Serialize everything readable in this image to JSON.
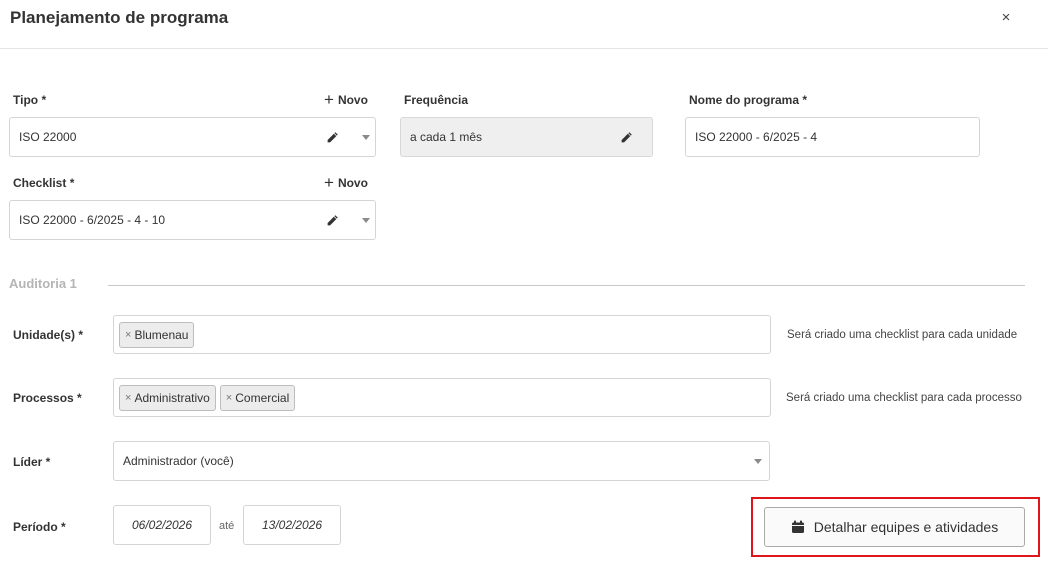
{
  "modal": {
    "title": "Planejamento de programa",
    "close": "×"
  },
  "form": {
    "tipo": {
      "label": "Tipo *",
      "value": "ISO 22000",
      "novo_label": "Novo"
    },
    "frequencia": {
      "label": "Frequência",
      "value": "a cada 1 mês"
    },
    "nome_programa": {
      "label": "Nome do programa *",
      "value": "ISO 22000 - 6/2025 - 4"
    },
    "checklist": {
      "label": "Checklist *",
      "value": "ISO 22000 - 6/2025 - 4 - 10",
      "novo_label": "Novo"
    }
  },
  "auditoria": {
    "title": "Auditoria 1",
    "unidades": {
      "label": "Unidade(s) *",
      "tags": [
        "Blumenau"
      ],
      "hint": "Será criado uma checklist para cada unidade"
    },
    "processos": {
      "label": "Processos *",
      "tags": [
        "Administrativo",
        "Comercial"
      ],
      "hint": "Será criado uma checklist para cada processo"
    },
    "lider": {
      "label": "Líder *",
      "value": "Administrador (você)"
    },
    "periodo": {
      "label": "Período *",
      "start": "06/02/2026",
      "separator": "até",
      "end": "13/02/2026"
    },
    "detail_button": {
      "label": "Detalhar equipes e atividades"
    }
  },
  "tag_remove": "×",
  "icons": {
    "pencil": "pencil-icon",
    "calendar": "calendar-icon",
    "caret": "caret-down-icon",
    "plus": "plus-icon",
    "close": "close-icon"
  },
  "colors": {
    "highlight": "#e0151c",
    "section": "#b5b5b5",
    "readonly_bg": "#efefef"
  }
}
